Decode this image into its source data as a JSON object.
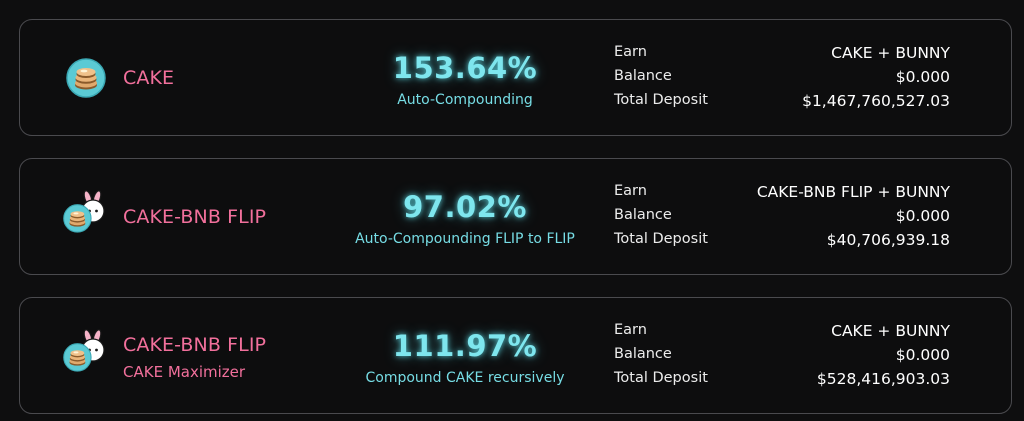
{
  "pools": [
    {
      "name": "CAKE",
      "subtitle": "",
      "apy": "153.64%",
      "apy_description": "Auto-Compounding",
      "earn_label": "Earn",
      "earn_value": "CAKE + BUNNY",
      "balance_label": "Balance",
      "balance_value": "$0.000",
      "deposit_label": "Total Deposit",
      "deposit_value": "$1,467,760,527.03",
      "icon": "cake-token-icon"
    },
    {
      "name": "CAKE-BNB FLIP",
      "subtitle": "",
      "apy": "97.02%",
      "apy_description": "Auto-Compounding FLIP to FLIP",
      "earn_label": "Earn",
      "earn_value": "CAKE-BNB FLIP + BUNNY",
      "balance_label": "Balance",
      "balance_value": "$0.000",
      "deposit_label": "Total Deposit",
      "deposit_value": "$40,706,939.18",
      "icon": "cake-bunny-flip-icon"
    },
    {
      "name": "CAKE-BNB FLIP",
      "subtitle": "CAKE Maximizer",
      "apy": "111.97%",
      "apy_description": "Compound CAKE recursively",
      "earn_label": "Earn",
      "earn_value": "CAKE + BUNNY",
      "balance_label": "Balance",
      "balance_value": "$0.000",
      "deposit_label": "Total Deposit",
      "deposit_value": "$528,416,903.03",
      "icon": "cake-bunny-flip-icon"
    }
  ],
  "colors": {
    "pool_name": "#f2709c",
    "apy": "#7ee6ee",
    "card_border": "#4a4a4e",
    "background": "#0e0e0f"
  }
}
